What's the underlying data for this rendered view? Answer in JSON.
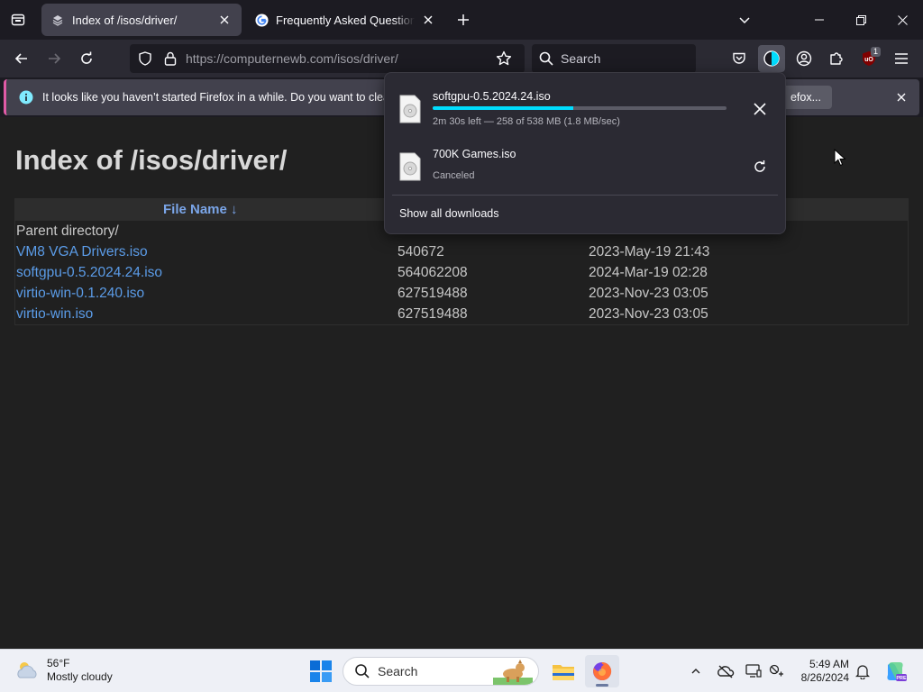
{
  "tabs": [
    {
      "title": "Index of /isos/driver/",
      "active": true
    },
    {
      "title": "Frequently Asked Questions | ",
      "active": false
    }
  ],
  "navbar": {
    "url_host": "https://computernewb.com",
    "url_path": "/isos/driver/",
    "search_placeholder": "Search",
    "extension_badge": "1"
  },
  "notification": {
    "message": "It looks like you haven’t started Firefox in a while. Do you want to clean it",
    "button_label": "efox..."
  },
  "page": {
    "heading": "Index of /isos/driver/",
    "column_header": "File Name  ↓",
    "rows": [
      {
        "name": "Parent directory/",
        "size": "",
        "date": ""
      },
      {
        "name": "VM8 VGA Drivers.iso",
        "size": "540672",
        "date": "2023-May-19 21:43"
      },
      {
        "name": "softgpu-0.5.2024.24.iso",
        "size": "564062208",
        "date": "2024-Mar-19 02:28"
      },
      {
        "name": "virtio-win-0.1.240.iso",
        "size": "627519488",
        "date": "2023-Nov-23 03:05"
      },
      {
        "name": "virtio-win.iso",
        "size": "627519488",
        "date": "2023-Nov-23 03:05"
      }
    ]
  },
  "downloads": {
    "items": [
      {
        "name": "softgpu-0.5.2024.24.iso",
        "status": "2m 30s left — 258 of 538 MB (1.8 MB/sec)",
        "progress": 0.48
      },
      {
        "name": "700K Games.iso",
        "status": "Canceled"
      }
    ],
    "show_all": "Show all downloads"
  },
  "taskbar": {
    "weather_temp": "56°F",
    "weather_desc": "Mostly cloudy",
    "search_label": "Search",
    "time": "5:49 AM",
    "date": "8/26/2024"
  },
  "colors": {
    "accent": "#00ddff",
    "link": "#5b9ce8",
    "notification_accent": "#e15ba6"
  }
}
